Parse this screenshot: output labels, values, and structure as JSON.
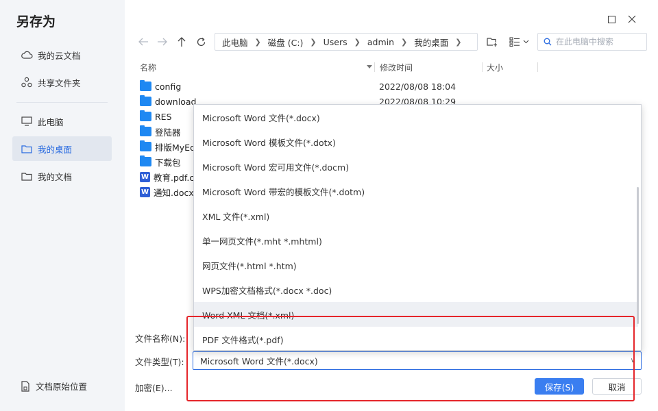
{
  "dialog": {
    "title": "另存为"
  },
  "sidebar": {
    "items": [
      {
        "label": "我的云文档",
        "icon": "cloud-icon"
      },
      {
        "label": "共享文件夹",
        "icon": "share-icon"
      },
      {
        "label": "此电脑",
        "icon": "monitor-icon"
      },
      {
        "label": "我的桌面",
        "icon": "folder-icon",
        "active": true
      },
      {
        "label": "我的文档",
        "icon": "folder-icon"
      }
    ],
    "bottom_label": "文档原始位置"
  },
  "breadcrumb": [
    "此电脑",
    "磁盘 (C:)",
    "Users",
    "admin",
    "我的桌面"
  ],
  "search": {
    "placeholder": "在此电脑中搜索"
  },
  "columns": {
    "name": "名称",
    "modified": "修改时间",
    "size": "大小"
  },
  "files": [
    {
      "name": "config",
      "type": "folder",
      "date": "2022/08/08 18:04"
    },
    {
      "name": "download",
      "type": "folder",
      "date": "2022/08/08 10:29"
    },
    {
      "name": "RES",
      "type": "folder",
      "date": ""
    },
    {
      "name": "登陆器",
      "type": "folder",
      "date": ""
    },
    {
      "name": "排版MyEd",
      "type": "folder",
      "date": ""
    },
    {
      "name": "下载包",
      "type": "folder",
      "date": ""
    },
    {
      "name": "教育.pdf.c",
      "type": "word",
      "date": ""
    },
    {
      "name": "通知.docx",
      "type": "word",
      "date": ""
    }
  ],
  "form": {
    "filename_label": "文件名称(N):",
    "filetype_label": "文件类型(T):",
    "encrypt_label": "加密(E)...",
    "selected_type": "Microsoft Word 文件(*.docx)"
  },
  "dropdown_options": [
    "Microsoft Word 文件(*.docx)",
    "Microsoft Word 模板文件(*.dotx)",
    "Microsoft Word 宏可用文件(*.docm)",
    "Microsoft Word 带宏的模板文件(*.dotm)",
    "XML 文件(*.xml)",
    "单一网页文件(*.mht *.mhtml)",
    "网页文件(*.html *.htm)",
    "WPS加密文档格式(*.docx *.doc)",
    "Word XML 文档(*.xml)",
    "PDF 文件格式(*.pdf)"
  ],
  "buttons": {
    "save": "保存(S)",
    "cancel": "取消"
  },
  "colors": {
    "accent": "#3a7ef0",
    "highlight": "#e5252a",
    "folder": "#1e88f2"
  }
}
